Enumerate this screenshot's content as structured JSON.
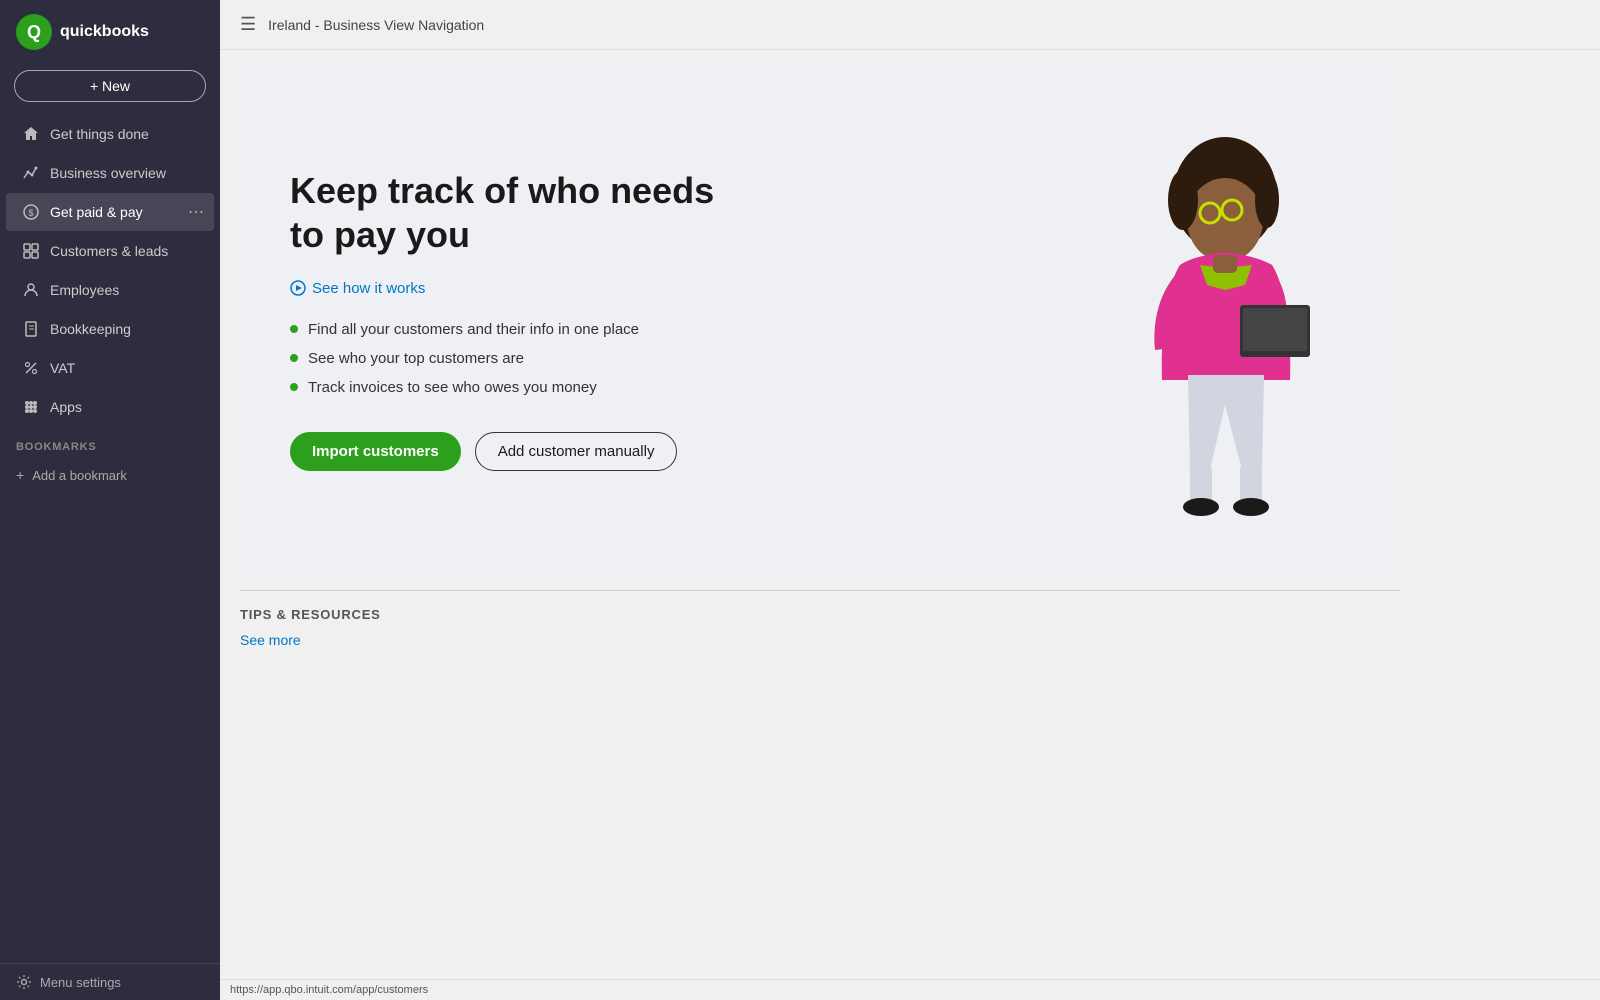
{
  "sidebar": {
    "logo_text": "quickbooks",
    "new_button_label": "+ New",
    "nav_items": [
      {
        "id": "get-things-done",
        "label": "Get things done",
        "icon": "home"
      },
      {
        "id": "business-overview",
        "label": "Business overview",
        "icon": "chart"
      },
      {
        "id": "get-paid-pay",
        "label": "Get paid & pay",
        "icon": "dollar",
        "active": true
      },
      {
        "id": "customers-leads",
        "label": "Customers & leads",
        "icon": "grid"
      },
      {
        "id": "employees",
        "label": "Employees",
        "icon": "person"
      },
      {
        "id": "bookkeeping",
        "label": "Bookkeeping",
        "icon": "book"
      },
      {
        "id": "vat",
        "label": "VAT",
        "icon": "percent"
      },
      {
        "id": "apps",
        "label": "Apps",
        "icon": "apps"
      }
    ],
    "bookmarks_label": "BOOKMARKS",
    "add_bookmark_label": "Add a bookmark",
    "footer_label": "Menu settings"
  },
  "header": {
    "title": "Ireland - Business View Navigation"
  },
  "main": {
    "card": {
      "title_line1": "Keep track of who needs",
      "title_line2": "to pay you",
      "see_how_label": "See how it works",
      "bullets": [
        "Find all your customers and their info in one place",
        "See who your top customers are",
        "Track invoices to see who owes you money"
      ],
      "import_btn_label": "Import customers",
      "add_manual_btn_label": "Add customer manually"
    },
    "tips_section": {
      "title": "TIPS & RESOURCES",
      "see_more_label": "See more"
    }
  },
  "url_bar": {
    "url": "https://app.qbo.intuit.com/app/customers"
  }
}
